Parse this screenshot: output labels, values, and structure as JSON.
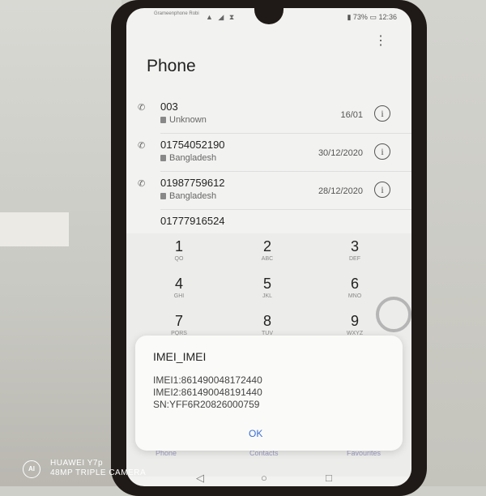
{
  "status_bar": {
    "carrier": "Grameenphone Robi",
    "battery": "73%",
    "time": "12:36"
  },
  "header": {
    "title": "Phone",
    "menu_icon": "more-vert-icon"
  },
  "call_log": [
    {
      "number": "003",
      "location": "Unknown",
      "date": "16/01"
    },
    {
      "number": "01754052190",
      "location": "Bangladesh",
      "date": "30/12/2020"
    },
    {
      "number": "01987759612",
      "location": "Bangladesh",
      "date": "28/12/2020"
    },
    {
      "number": "01777916524",
      "location": "",
      "date": ""
    }
  ],
  "dialpad": [
    {
      "digit": "1",
      "letters": "QO"
    },
    {
      "digit": "2",
      "letters": "ABC"
    },
    {
      "digit": "3",
      "letters": "DEF"
    },
    {
      "digit": "4",
      "letters": "GHI"
    },
    {
      "digit": "5",
      "letters": "JKL"
    },
    {
      "digit": "6",
      "letters": "MNO"
    },
    {
      "digit": "7",
      "letters": "PQRS"
    },
    {
      "digit": "8",
      "letters": "TUV"
    },
    {
      "digit": "9",
      "letters": "WXYZ"
    }
  ],
  "dialog": {
    "title": "IMEI_IMEI",
    "imei1": "IMEI1:861490048172440",
    "imei2": "IMEI2:861490048191440",
    "sn": "SN:YFF6R20826000759",
    "ok": "OK"
  },
  "tabs": {
    "phone": "Phone",
    "contacts": "Contacts",
    "favourites": "Favourites"
  },
  "watermark": {
    "brand": "HUAWEI Y7p",
    "camera": "48MP TRIPLE CAMERA",
    "ai": "AI"
  }
}
